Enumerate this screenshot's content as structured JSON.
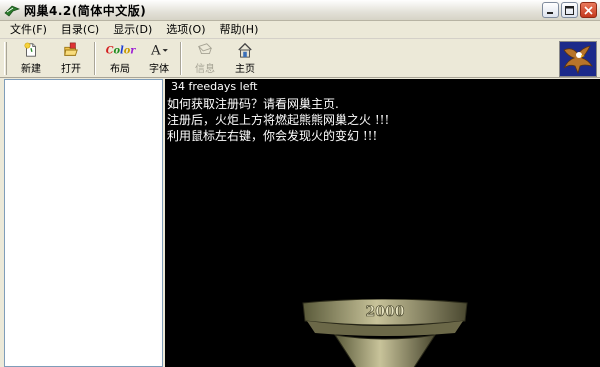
{
  "window": {
    "title": "网巢4.2(简体中文版)"
  },
  "menu": [
    {
      "label": "文件(F)"
    },
    {
      "label": "目录(C)"
    },
    {
      "label": "显示(D)"
    },
    {
      "label": "选项(O)"
    },
    {
      "label": "帮助(H)"
    }
  ],
  "toolbar": {
    "new_label": "新建",
    "open_label": "打开",
    "layout_label": "布局",
    "font_label": "字体",
    "info_label": "信息",
    "home_label": "主页",
    "layout_icon_text": "Color",
    "font_icon_text": "A"
  },
  "content": {
    "freedays": "34 freedays left",
    "line1": "如何获取注册码？请看网巢主页.",
    "line2": "注册后，火炬上方将燃起熊熊网巢之火 !!!",
    "line3": "利用鼠标左右键，你会发现火的变幻 !!!",
    "torch_text": "2000"
  },
  "colors": {
    "content_bg": "#000000",
    "content_text": "#ffffff",
    "logo_bg": "#1c2a8a"
  }
}
